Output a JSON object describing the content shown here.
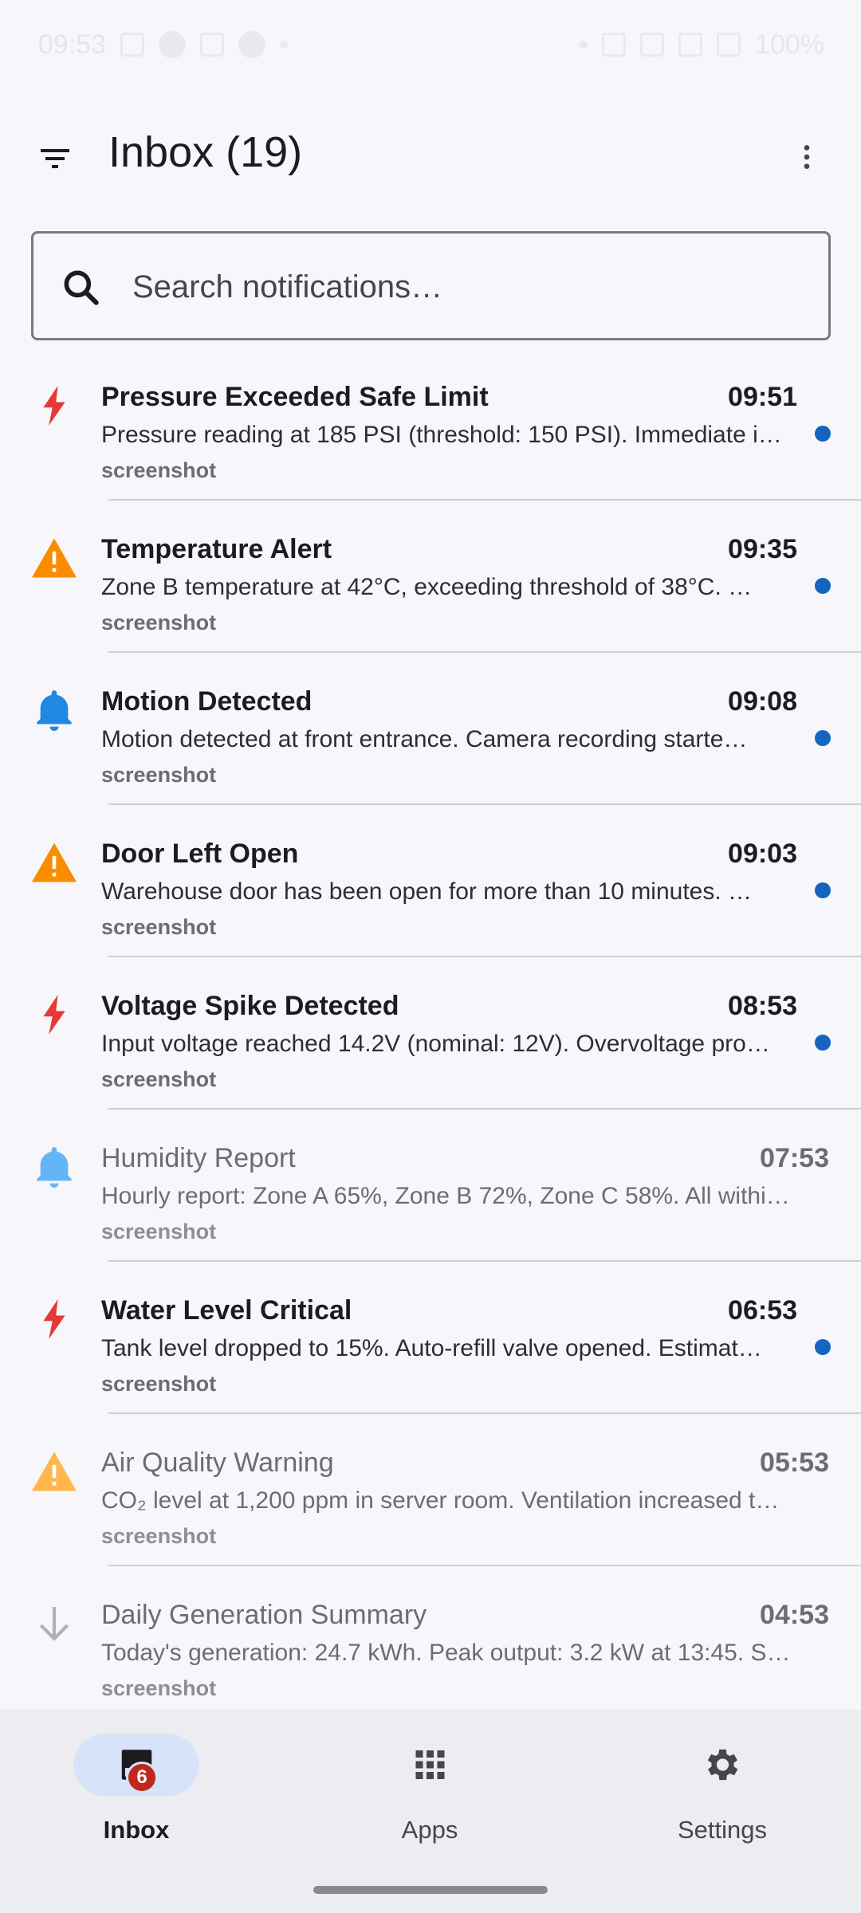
{
  "status_bar": {
    "time": "09:53",
    "battery": "100%"
  },
  "header": {
    "title": "Inbox (19)"
  },
  "search": {
    "placeholder": "Search notifications…",
    "value": ""
  },
  "notifications": [
    {
      "title": "Pressure Exceeded Safe Limit",
      "time": "09:51",
      "body": "Pressure reading at 185 PSI (threshold: 150 PSI). Immediate i…",
      "source": "screenshot",
      "icon": "bolt-icon",
      "unread": true
    },
    {
      "title": "Temperature Alert",
      "time": "09:35",
      "body": "Zone B temperature at 42°C, exceeding threshold of 38°C. …",
      "source": "screenshot",
      "icon": "warning-icon",
      "unread": true
    },
    {
      "title": "Motion Detected",
      "time": "09:08",
      "body": "Motion detected at front entrance. Camera recording starte…",
      "source": "screenshot",
      "icon": "bell-icon",
      "unread": true
    },
    {
      "title": "Door Left Open",
      "time": "09:03",
      "body": "Warehouse door has been open for more than 10 minutes. …",
      "source": "screenshot",
      "icon": "warning-icon",
      "unread": true
    },
    {
      "title": "Voltage Spike Detected",
      "time": "08:53",
      "body": "Input voltage reached 14.2V (nominal: 12V). Overvoltage pro…",
      "source": "screenshot",
      "icon": "bolt-icon",
      "unread": true
    },
    {
      "title": "Humidity Report",
      "time": "07:53",
      "body": "Hourly report: Zone A 65%, Zone B 72%, Zone C 58%. All withi…",
      "source": "screenshot",
      "icon": "bell-icon",
      "unread": false
    },
    {
      "title": "Water Level Critical",
      "time": "06:53",
      "body": "Tank level dropped to 15%. Auto-refill valve opened. Estimat…",
      "source": "screenshot",
      "icon": "bolt-icon",
      "unread": true
    },
    {
      "title": "Air Quality Warning",
      "time": "05:53",
      "body": "CO₂ level at 1,200 ppm in server room. Ventilation increased t…",
      "source": "screenshot",
      "icon": "warning-icon",
      "unread": false
    },
    {
      "title": "Daily Generation Summary",
      "time": "04:53",
      "body": "Today's generation: 24.7 kWh. Peak output: 3.2 kW at 13:45. S…",
      "source": "screenshot",
      "icon": "arrow-down-icon",
      "unread": false
    }
  ],
  "bottom_nav": {
    "inbox_label": "Inbox",
    "inbox_badge": "6",
    "apps_label": "Apps",
    "settings_label": "Settings"
  },
  "colors": {
    "bolt_unread": "#e53935",
    "bolt_read": "#ef9a9a",
    "warning_unread": "#fb8c00",
    "warning_read": "#ffb74d",
    "bell_unread": "#1e88e5",
    "bell_read": "#64b5f6",
    "arrow_read": "#b0b0b5",
    "unread_dot": "#1565c0"
  }
}
